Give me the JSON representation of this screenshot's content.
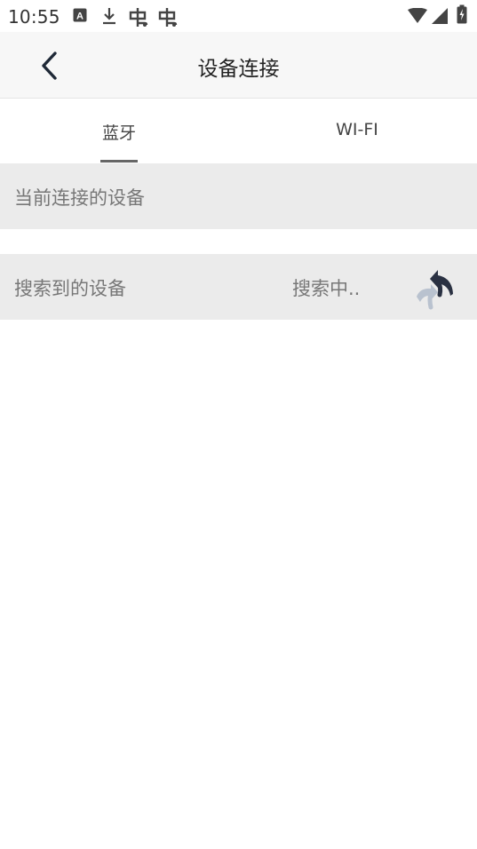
{
  "status_bar": {
    "time": "10:55",
    "notification_icons": [
      "a-badge-icon",
      "download-icon",
      "bug-icon",
      "bug-icon"
    ],
    "system_icons": [
      "wifi-icon",
      "cellular-signal-icon",
      "battery-charging-icon"
    ]
  },
  "app_bar": {
    "title": "设备连接",
    "back_icon": "chevron-left-icon"
  },
  "tabs": [
    {
      "label": "蓝牙",
      "selected": true
    },
    {
      "label": "WI-FI",
      "selected": false
    }
  ],
  "sections": {
    "connected": {
      "title": "当前连接的设备"
    },
    "found": {
      "title": "搜索到的设备",
      "status": "搜索中..",
      "refresh_icon": "refresh-arrows-icon"
    }
  },
  "colors": {
    "app_bar_bg": "#f7f7f7",
    "section_bg": "#ebebeb",
    "refresh_dark": "#2a3142",
    "refresh_light": "#b9c2cf"
  }
}
